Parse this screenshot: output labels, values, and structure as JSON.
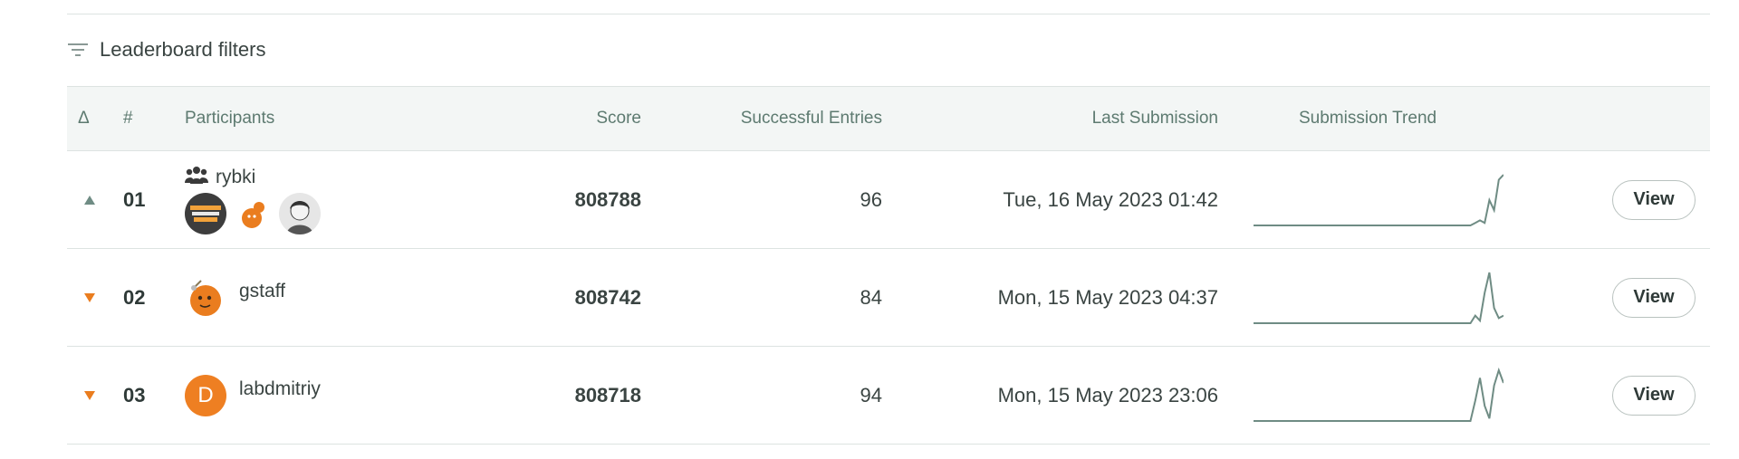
{
  "filters": {
    "label": "Leaderboard filters",
    "icon": "filter-icon"
  },
  "columns": {
    "delta": "Δ",
    "rank": "#",
    "participants": "Participants",
    "score": "Score",
    "entries": "Successful Entries",
    "last": "Last Submission",
    "trend": "Submission Trend"
  },
  "colors": {
    "up": "#6f8c84",
    "down": "#ea7d1f",
    "trend_line": "#6f8c84",
    "avatar_orange": "#ee7f22"
  },
  "rows": [
    {
      "delta": "up",
      "rank": "01",
      "name": "rybki",
      "is_team": true,
      "team_icon": "team-icon",
      "score": "808788",
      "entries": "96",
      "last_submission": "Tue, 16 May 2023 01:42",
      "trend_points": [
        0,
        0,
        0,
        0,
        0,
        0,
        0,
        0,
        0,
        0,
        0,
        0,
        0,
        0,
        0,
        0,
        0,
        0,
        0,
        0,
        0,
        0,
        0,
        0,
        0,
        0,
        0,
        0,
        0,
        0,
        0,
        0,
        0,
        0,
        0,
        0,
        0,
        0,
        0,
        0,
        0,
        0,
        0,
        0,
        0,
        0,
        0,
        0.05,
        0.1,
        0.05,
        0.5,
        0.3,
        0.9,
        1
      ],
      "action": "View"
    },
    {
      "delta": "down",
      "rank": "02",
      "name": "gstaff",
      "is_team": false,
      "score": "808742",
      "entries": "84",
      "last_submission": "Mon, 15 May 2023 04:37",
      "trend_points": [
        0,
        0,
        0,
        0,
        0,
        0,
        0,
        0,
        0,
        0,
        0,
        0,
        0,
        0,
        0,
        0,
        0,
        0,
        0,
        0,
        0,
        0,
        0,
        0,
        0,
        0,
        0,
        0,
        0,
        0,
        0,
        0,
        0,
        0,
        0,
        0,
        0,
        0,
        0,
        0,
        0,
        0,
        0,
        0,
        0,
        0,
        0,
        0.15,
        0.05,
        0.6,
        1,
        0.3,
        0.1,
        0.15
      ],
      "action": "View"
    },
    {
      "delta": "down",
      "rank": "03",
      "name": "labdmitriy",
      "is_team": false,
      "avatar_letter": "D",
      "score": "808718",
      "entries": "94",
      "last_submission": "Mon, 15 May 2023 23:06",
      "trend_points": [
        0,
        0,
        0,
        0,
        0,
        0,
        0,
        0,
        0,
        0,
        0,
        0,
        0,
        0,
        0,
        0,
        0,
        0,
        0,
        0,
        0,
        0,
        0,
        0,
        0,
        0,
        0,
        0,
        0,
        0,
        0,
        0,
        0,
        0,
        0,
        0,
        0,
        0,
        0,
        0,
        0,
        0,
        0,
        0,
        0,
        0,
        0,
        0.4,
        0.85,
        0.3,
        0.05,
        0.7,
        1,
        0.75
      ],
      "action": "View"
    }
  ]
}
